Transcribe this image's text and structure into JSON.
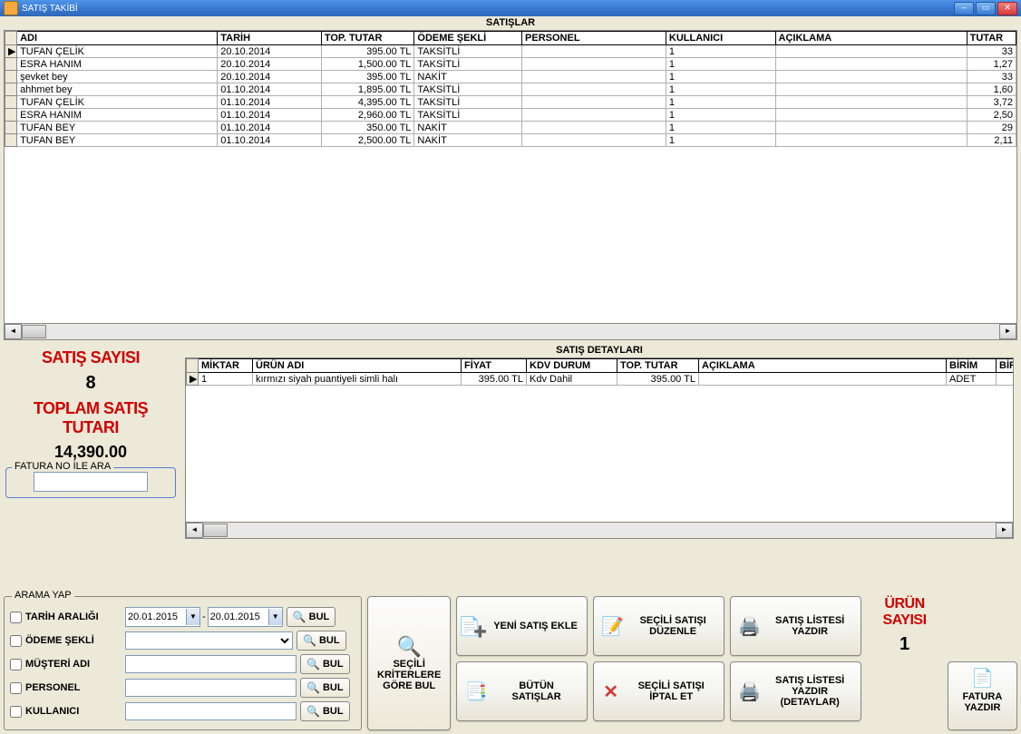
{
  "window": {
    "title": "SATIŞ TAKİBİ"
  },
  "salesGrid": {
    "title": "SATIŞLAR",
    "headers": [
      "ADI",
      "TARİH",
      "TOP. TUTAR",
      "ÖDEME ŞEKLİ",
      "PERSONEL",
      "KULLANICI",
      "AÇIKLAMA",
      "TUTAR"
    ],
    "rows": [
      {
        "adi": "TUFAN ÇELİK",
        "tarih": "20.10.2014",
        "tutar": "395.00 TL",
        "odeme": "TAKSİTLİ",
        "personel": "",
        "kullanici": "1",
        "aciklama": "",
        "tut": "33"
      },
      {
        "adi": "ESRA HANIM",
        "tarih": "20.10.2014",
        "tutar": "1,500.00 TL",
        "odeme": "TAKSİTLİ",
        "personel": "",
        "kullanici": "1",
        "aciklama": "",
        "tut": "1,27"
      },
      {
        "adi": "şevket bey",
        "tarih": "20.10.2014",
        "tutar": "395.00 TL",
        "odeme": "NAKİT",
        "personel": "",
        "kullanici": "1",
        "aciklama": "",
        "tut": "33"
      },
      {
        "adi": "ahhmet bey",
        "tarih": "01.10.2014",
        "tutar": "1,895.00 TL",
        "odeme": "TAKSİTLİ",
        "personel": "",
        "kullanici": "1",
        "aciklama": "",
        "tut": "1,60"
      },
      {
        "adi": "TUFAN ÇELİK",
        "tarih": "01.10.2014",
        "tutar": "4,395.00 TL",
        "odeme": "TAKSİTLİ",
        "personel": "",
        "kullanici": "1",
        "aciklama": "",
        "tut": "3,72"
      },
      {
        "adi": "ESRA HANIM",
        "tarih": "01.10.2014",
        "tutar": "2,960.00 TL",
        "odeme": "TAKSİTLİ",
        "personel": "",
        "kullanici": "1",
        "aciklama": "",
        "tut": "2,50"
      },
      {
        "adi": "TUFAN BEY",
        "tarih": "01.10.2014",
        "tutar": "350.00 TL",
        "odeme": "NAKİT",
        "personel": "",
        "kullanici": "1",
        "aciklama": "",
        "tut": "29"
      },
      {
        "adi": "TUFAN BEY",
        "tarih": "01.10.2014",
        "tutar": "2,500.00 TL",
        "odeme": "NAKİT",
        "personel": "",
        "kullanici": "1",
        "aciklama": "",
        "tut": "2,11"
      }
    ]
  },
  "summary": {
    "countLabel": "SATIŞ SAYISI",
    "count": "8",
    "totalLabel1": "TOPLAM SATIŞ",
    "totalLabel2": "TUTARI",
    "total": "14,390.00",
    "faturaLegend": "FATURA NO İLE ARA"
  },
  "detailsGrid": {
    "title": "SATIŞ DETAYLARI",
    "headers": [
      "MİKTAR",
      "ÜRÜN ADI",
      "FİYAT",
      "KDV DURUM",
      "TOP. TUTAR",
      "AÇIKLAMA",
      "BİRİM",
      "BİRİM"
    ],
    "row": {
      "miktar": "1",
      "urun": "kırmızı siyah puantiyeli simli halı",
      "fiyat": "395.00 TL",
      "kdv": "Kdv Dahil",
      "top": "395.00 TL",
      "aciklama": "",
      "birim": "ADET",
      "birim2": ""
    }
  },
  "search": {
    "legend": "ARAMA YAP",
    "tarih": "TARİH ARALIĞI",
    "odeme": "ÖDEME ŞEKLİ",
    "musteri": "MÜŞTERİ ADI",
    "personel": "PERSONEL",
    "kullanici": "KULLANICI",
    "bul": "BUL",
    "date1": "20.01.2015",
    "date2": "20.01.2015",
    "kriter1": "SEÇİLİ",
    "kriter2": "KRİTERLERE",
    "kriter3": "GÖRE BUL"
  },
  "actions": {
    "yeni": "YENİ SATIŞ EKLE",
    "duzenle": "SEÇİLİ SATIŞI DÜZENLE",
    "liste": "SATIŞ LİSTESİ YAZDIR",
    "butun": "BÜTÜN SATIŞLAR",
    "iptal": "SEÇİLİ SATIŞI İPTAL ET",
    "detay": "SATIŞ LİSTESİ YAZDIR (DETAYLAR)",
    "fatura": "FATURA YAZDIR"
  },
  "productSummary": {
    "label1": "ÜRÜN",
    "label2": "SAYISI",
    "count": "1"
  }
}
